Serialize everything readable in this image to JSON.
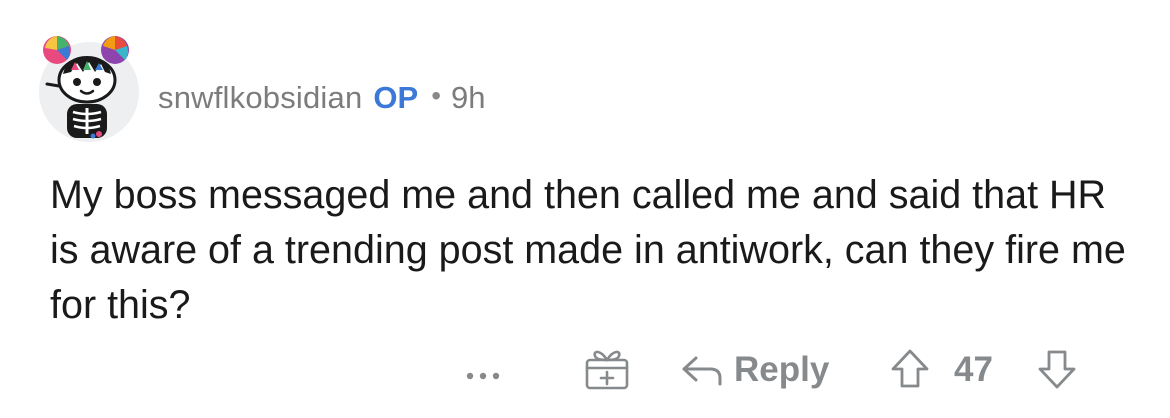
{
  "comment": {
    "author": "snwflkobsidian",
    "op_badge": "OP",
    "separator": "•",
    "age": "9h",
    "body": "My boss messaged me and then called me and said that HR is aware of a trending post made in antiwork, can they fire me for this?",
    "avatar_icon": "snoo-avatar-icon"
  },
  "actions": {
    "more_icon": "more-options-icon",
    "award_icon": "award-gift-icon",
    "reply_label": "Reply",
    "reply_icon": "reply-arrow-icon",
    "upvote_icon": "upvote-arrow-icon",
    "vote_count": "47",
    "downvote_icon": "downvote-arrow-icon"
  },
  "colors": {
    "username": "#7c7c7c",
    "op_badge": "#3b78d8",
    "body_text": "#1a1a1b",
    "action_gray": "#878a8c",
    "avatar_bg": "#edeff1"
  }
}
